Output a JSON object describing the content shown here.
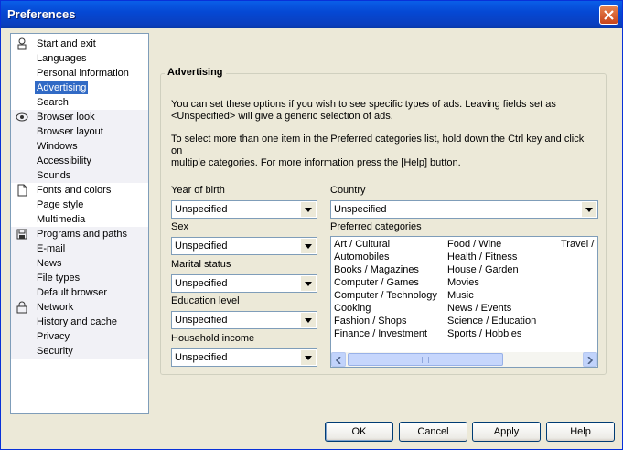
{
  "window": {
    "title": "Preferences",
    "close_icon": "close-icon"
  },
  "nav": [
    {
      "icon": "person-icon",
      "items": [
        "Start and exit",
        "Languages",
        "Personal information",
        "Advertising"
      ]
    },
    {
      "icon": "",
      "items": [
        "Search"
      ]
    },
    {
      "icon": "eye-icon",
      "items": [
        "Browser look",
        "Browser layout",
        "Windows",
        "Accessibility",
        "Sounds"
      ]
    },
    {
      "icon": "page-icon",
      "items": [
        "Fonts and colors",
        "Page style",
        "Multimedia"
      ]
    },
    {
      "icon": "disk-icon",
      "items": [
        "Programs and paths",
        "E-mail",
        "News",
        "File types",
        "Default browser"
      ]
    },
    {
      "icon": "lock-icon",
      "items": [
        "Network",
        "History and cache",
        "Privacy",
        "Security"
      ]
    }
  ],
  "nav_selected": "Advertising",
  "panel": {
    "title": "Advertising",
    "para1_line1": "You can set these options if you wish to see specific types of ads. Leaving fields set as",
    "para1_line2": "<Unspecified> will give a generic selection of ads.",
    "para2_line1": "To select more than one item in the Preferred categories list, hold down the Ctrl key and click on",
    "para2_line2": "multiple categories. For more information press the [Help] button.",
    "fields": {
      "year_of_birth": {
        "label": "Year of birth",
        "value": "Unspecified"
      },
      "sex": {
        "label": "Sex",
        "value": "Unspecified"
      },
      "marital_status": {
        "label": "Marital status",
        "value": "Unspecified"
      },
      "education_level": {
        "label": "Education level",
        "value": "Unspecified"
      },
      "household_income": {
        "label": "Household income",
        "value": "Unspecified"
      },
      "country": {
        "label": "Country",
        "value": "Unspecified"
      }
    },
    "categories_label": "Preferred categories",
    "categories": {
      "col1": [
        "Art / Cultural",
        "Automobiles",
        "Books / Magazines",
        "Computer / Games",
        "Computer / Technology",
        "Cooking",
        "Fashion / Shops",
        "Finance / Investment"
      ],
      "col2": [
        "Food / Wine",
        "Health / Fitness",
        "House / Garden",
        "Movies",
        "Music",
        "News / Events",
        "Science / Education",
        "Sports / Hobbies"
      ],
      "col3": [
        "Travel /"
      ]
    }
  },
  "buttons": {
    "ok": "OK",
    "cancel": "Cancel",
    "apply": "Apply",
    "help": "Help"
  }
}
